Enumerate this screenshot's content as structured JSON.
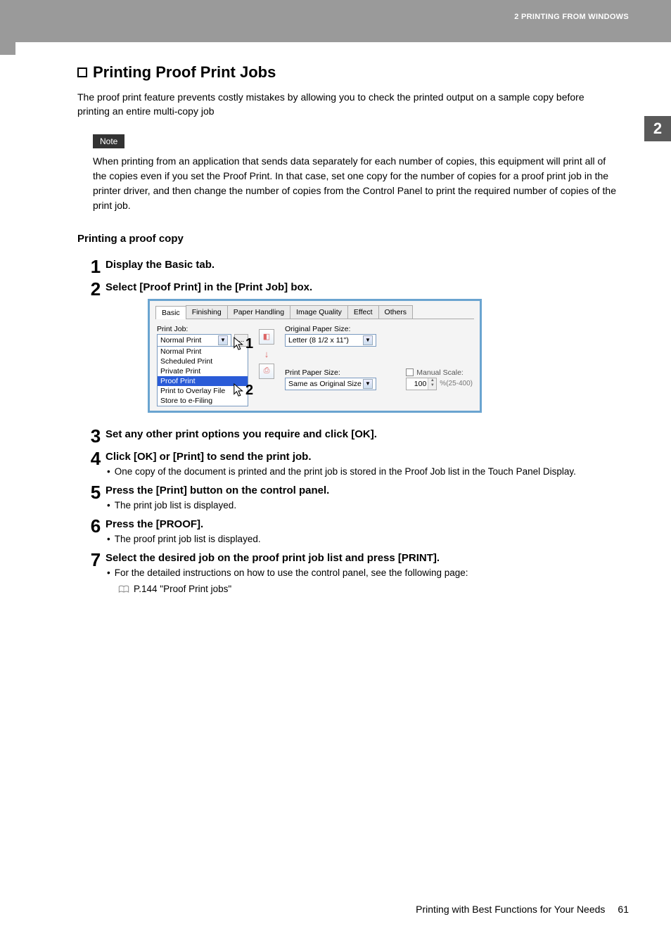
{
  "header": {
    "running_head": "2 PRINTING FROM WINDOWS",
    "side_tab": "2"
  },
  "section": {
    "title": "Printing Proof Print Jobs",
    "intro": "The proof print feature prevents costly mistakes by allowing you to check the printed output on a sample copy before printing an entire multi-copy job"
  },
  "note": {
    "label": "Note",
    "text": "When printing from an application that sends data separately for each number of copies, this equipment will print all of the copies even if you set the Proof Print.  In that case, set one copy for the number of copies for a proof print job in the printer driver, and then change the number of copies from the Control Panel to print the required number of copies of the print job."
  },
  "subheading": "Printing a proof copy",
  "steps": [
    {
      "num": "1",
      "title": "Display the Basic tab."
    },
    {
      "num": "2",
      "title": "Select [Proof Print] in the [Print Job] box."
    },
    {
      "num": "3",
      "title": "Set any other print options you require and click [OK]."
    },
    {
      "num": "4",
      "title": "Click [OK] or [Print] to send the print job.",
      "sub": "One copy of the document is printed and the print job is stored in the Proof Job list in the Touch Panel Display."
    },
    {
      "num": "5",
      "title": "Press the [Print] button on the control panel.",
      "sub": "The print job list is displayed."
    },
    {
      "num": "6",
      "title": "Press the [PROOF].",
      "sub": "The proof print job list is displayed."
    },
    {
      "num": "7",
      "title": "Select the desired job on the proof print job list and press [PRINT].",
      "sub": "For the detailed instructions on how to use the control panel, see the following page:",
      "ref": "P.144 \"Proof Print jobs\""
    }
  ],
  "dialog": {
    "tabs": [
      "Basic",
      "Finishing",
      "Paper Handling",
      "Image Quality",
      "Effect",
      "Others"
    ],
    "print_job_label": "Print Job:",
    "print_job_value": "Normal Print",
    "options": [
      "Normal Print",
      "Scheduled Print",
      "Private Print",
      "Proof Print",
      "Print to Overlay File",
      "Store to e-Filing"
    ],
    "pointer1": "1",
    "pointer2": "2",
    "original_paper_label": "Original Paper Size:",
    "original_paper_value": "Letter (8 1/2 x 11\")",
    "print_paper_label": "Print Paper Size:",
    "print_paper_value": "Same as Original Size",
    "manual_scale_label": "Manual Scale:",
    "manual_scale_value": "100",
    "manual_scale_range": "%(25-400)"
  },
  "footer": {
    "text": "Printing with Best Functions for Your Needs",
    "page": "61"
  }
}
